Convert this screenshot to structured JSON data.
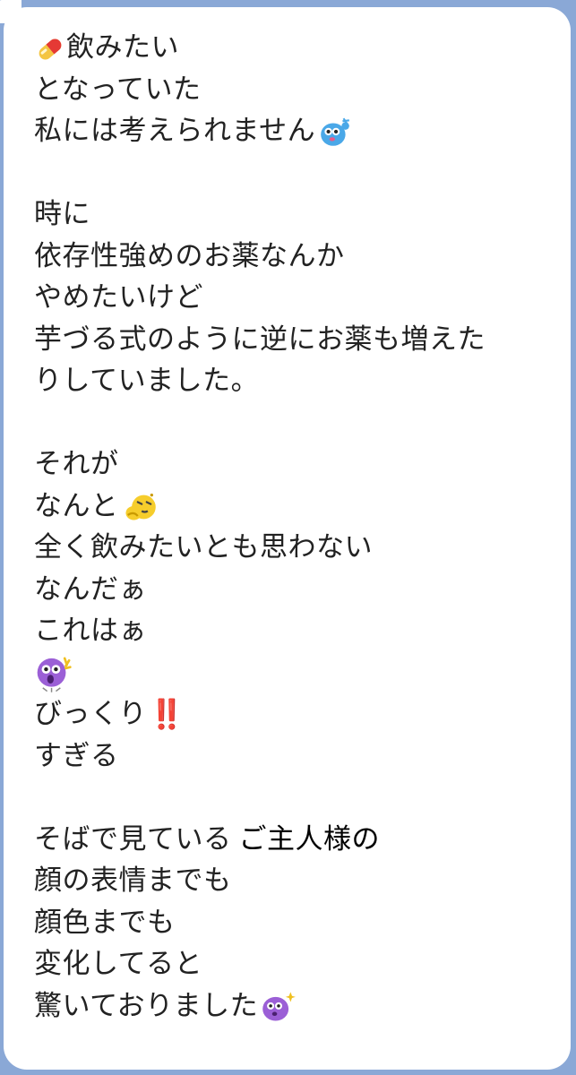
{
  "message": {
    "lines": [
      {
        "text": "飲みたい",
        "lead_icon": "pill-icon"
      },
      {
        "text": "となっていた"
      },
      {
        "text": "私には考えられません",
        "trail_icon": "blue-blob-sticker-icon"
      },
      {
        "text": ""
      },
      {
        "text": "時に"
      },
      {
        "text": "依存性強めのお薬なんか"
      },
      {
        "text": "やめたいけど"
      },
      {
        "text": "芋づる式のように逆にお薬も増えた"
      },
      {
        "text": "りしていました。"
      },
      {
        "text": ""
      },
      {
        "text": "それが"
      },
      {
        "text": "なんと",
        "trail_icon": "yellow-thinking-blob-icon"
      },
      {
        "text": "全く飲みたいとも思わない"
      },
      {
        "text": "なんだぁ"
      },
      {
        "text": "これはぁ"
      },
      {
        "text": "",
        "lead_icon": "purple-shocked-blob-icon"
      },
      {
        "text": "びっくり",
        "trail_text": "‼️"
      },
      {
        "text": "すぎる"
      },
      {
        "text": ""
      },
      {
        "text": "そばで見ている",
        "trail_text": "ご主人様の"
      },
      {
        "text": "顔の表情までも"
      },
      {
        "text": "顔色までも"
      },
      {
        "text": "変化してると"
      },
      {
        "text": "驚いておりました",
        "trail_icon": "purple-sparkle-blob-icon"
      }
    ]
  },
  "colors": {
    "chat_background": "#8aa8d6",
    "bubble": "#ffffff",
    "text": "#222222",
    "exclamation": "#e03a3a"
  }
}
